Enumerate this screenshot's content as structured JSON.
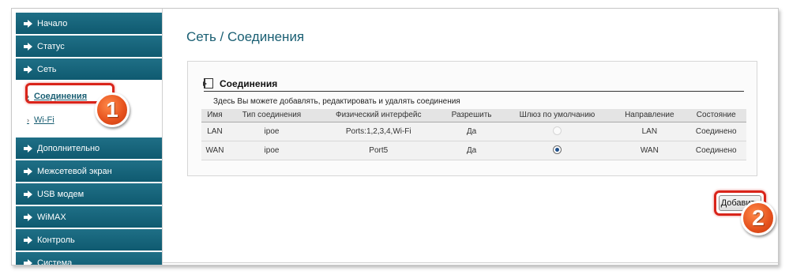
{
  "sidebar": {
    "items_top": [
      {
        "label": "Начало"
      },
      {
        "label": "Статус"
      },
      {
        "label": "Сеть"
      }
    ],
    "sub_items": [
      {
        "label": "Соединения",
        "active": true
      },
      {
        "label": "Wi-Fi",
        "active": false
      }
    ],
    "items_bottom": [
      {
        "label": "Дополнительно"
      },
      {
        "label": "Межсетевой экран"
      },
      {
        "label": "USB модем"
      },
      {
        "label": "WiMAX"
      },
      {
        "label": "Контроль"
      },
      {
        "label": "Система"
      }
    ]
  },
  "badges": {
    "one": "1",
    "two": "2"
  },
  "main": {
    "page_title": "Сеть / Соединения",
    "panel_title": "Соединения",
    "panel_desc": "Здесь Вы можете добавлять, редактировать и удалять соединения",
    "table": {
      "headers": [
        "Имя",
        "Тип соединения",
        "Физический интерфейс",
        "Разрешить",
        "Шлюз по умолчанию",
        "Направление",
        "Состояние"
      ],
      "rows": [
        {
          "name": "LAN",
          "type": "ipoe",
          "iface": "Ports:1,2,3,4,Wi-Fi",
          "allow": "Да",
          "gateway": "unchecked",
          "direction": "LAN",
          "state": "Соединено"
        },
        {
          "name": "WAN",
          "type": "ipoe",
          "iface": "Port5",
          "allow": "Да",
          "gateway": "checked",
          "direction": "WAN",
          "state": "Соединено"
        }
      ]
    },
    "add_button": "Добавить"
  },
  "colors": {
    "menu_bg": "#1f6f86",
    "highlight": "#d9241a",
    "badge": "#e5501c",
    "title": "#1a5f73"
  },
  "icons": {
    "menu_arrow": "arrow-right-icon",
    "panel": "connections-icon"
  }
}
